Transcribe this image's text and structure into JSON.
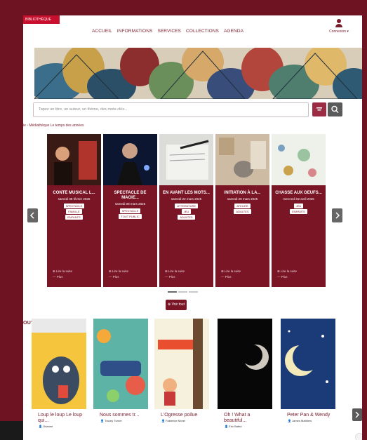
{
  "topbar": {
    "red_tag": "BIBLIOTHÈQUE",
    "nav": [
      "ACCUEIL",
      "INFORMATIONS",
      "SERVICES",
      "COLLECTIONS",
      "AGENDA"
    ],
    "user_label": "Connexion ▾"
  },
  "search": {
    "placeholder": "Tapez un titre, un auteur, un thème, des mots-clés..."
  },
  "breadcrumb": {
    "prefix": "ie",
    "link": "Médiathèque Le temps des années"
  },
  "events": [
    {
      "title": "CONTE MUSICAL L...",
      "date": "samedi 08 février 2025",
      "tags": [
        "SPECTACLE",
        "FAMILLE",
        "ENFANTS"
      ],
      "read_more": "Lire la suite",
      "more": "Plus"
    },
    {
      "title": "SPECTACLE DE MAGIE...",
      "date": "samedi 08 mars 2025",
      "tags": [
        "SPECTACLE",
        "TOUT PUBLIC"
      ],
      "read_more": "Lire la suite",
      "more": "Plus"
    },
    {
      "title": "EN AVANT LES MOTS...",
      "date": "samedi 22 mars 2025",
      "tags": [
        "LITTERATURE",
        "JEU",
        "ADULTES"
      ],
      "read_more": "Lire la suite",
      "more": "Plus"
    },
    {
      "title": "INITIATION À LA...",
      "date": "samedi 29 mars 2025",
      "tags": [
        "ATELIER",
        "ADULTES"
      ],
      "read_more": "Lire la suite",
      "more": "Plus"
    },
    {
      "title": "CHASSE AUX OEUFS...",
      "date": "mercredi 02 avril 2025",
      "tags": [
        "JEU",
        "ENFANTS"
      ],
      "read_more": "Lire la suite",
      "more": "Plus"
    }
  ],
  "voir_tout": "Voir tout",
  "section": {
    "title": "OUVEAUTÉS"
  },
  "books": [
    {
      "title": "Loup le loup Le loup qui...",
      "author": "Orianne"
    },
    {
      "title": "Nous sommes tr...",
      "author": "Tracey Turner"
    },
    {
      "title": "L'Ogresse poilue",
      "author": "Fabienne Morel"
    },
    {
      "title": "Oh ! What a beautiful...",
      "author": "Eric Battut"
    },
    {
      "title": "Peter Pan & Wendy",
      "author": "James Matthew"
    }
  ],
  "colors": {
    "frame": "#6e1322",
    "accent": "#7a1526",
    "link": "#7a1c2c"
  }
}
